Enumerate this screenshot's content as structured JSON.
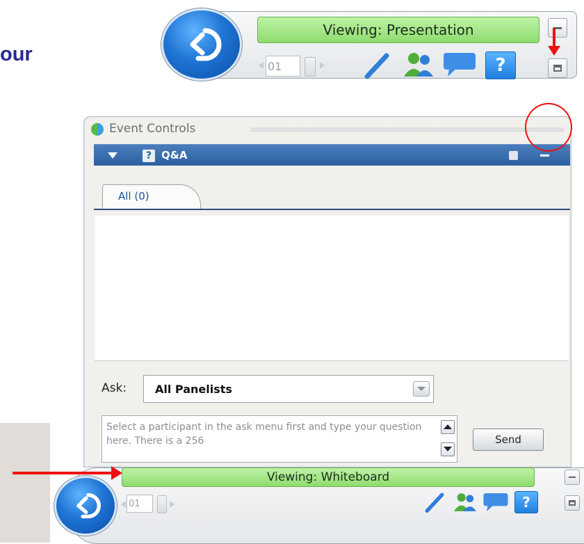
{
  "slide": {
    "partial_text": "our"
  },
  "top_toolbar": {
    "status": "Viewing: Presentation",
    "page_number": "01"
  },
  "event_controls": {
    "title": "Event Controls",
    "section": {
      "label": "Q&A",
      "icon": "question-icon"
    },
    "tabs": [
      {
        "label": "All (0)"
      }
    ],
    "ask": {
      "label": "Ask:",
      "selected": "All Panelists"
    },
    "question_placeholder": "Select a participant in the ask menu first and type your question here. There is a 256",
    "send_label": "Send"
  },
  "bottom_toolbar": {
    "status": "Viewing: Whiteboard",
    "page_number": "01"
  },
  "icons": [
    "back-arrow-icon",
    "pencil-icon",
    "participants-icon",
    "chat-icon",
    "question-icon",
    "minimize-icon",
    "restore-icon"
  ],
  "colors": {
    "status_green": "#9be07a",
    "header_blue": "#2f6aad",
    "annotation_red": "#ee1111",
    "slide_text": "#272a8e"
  }
}
